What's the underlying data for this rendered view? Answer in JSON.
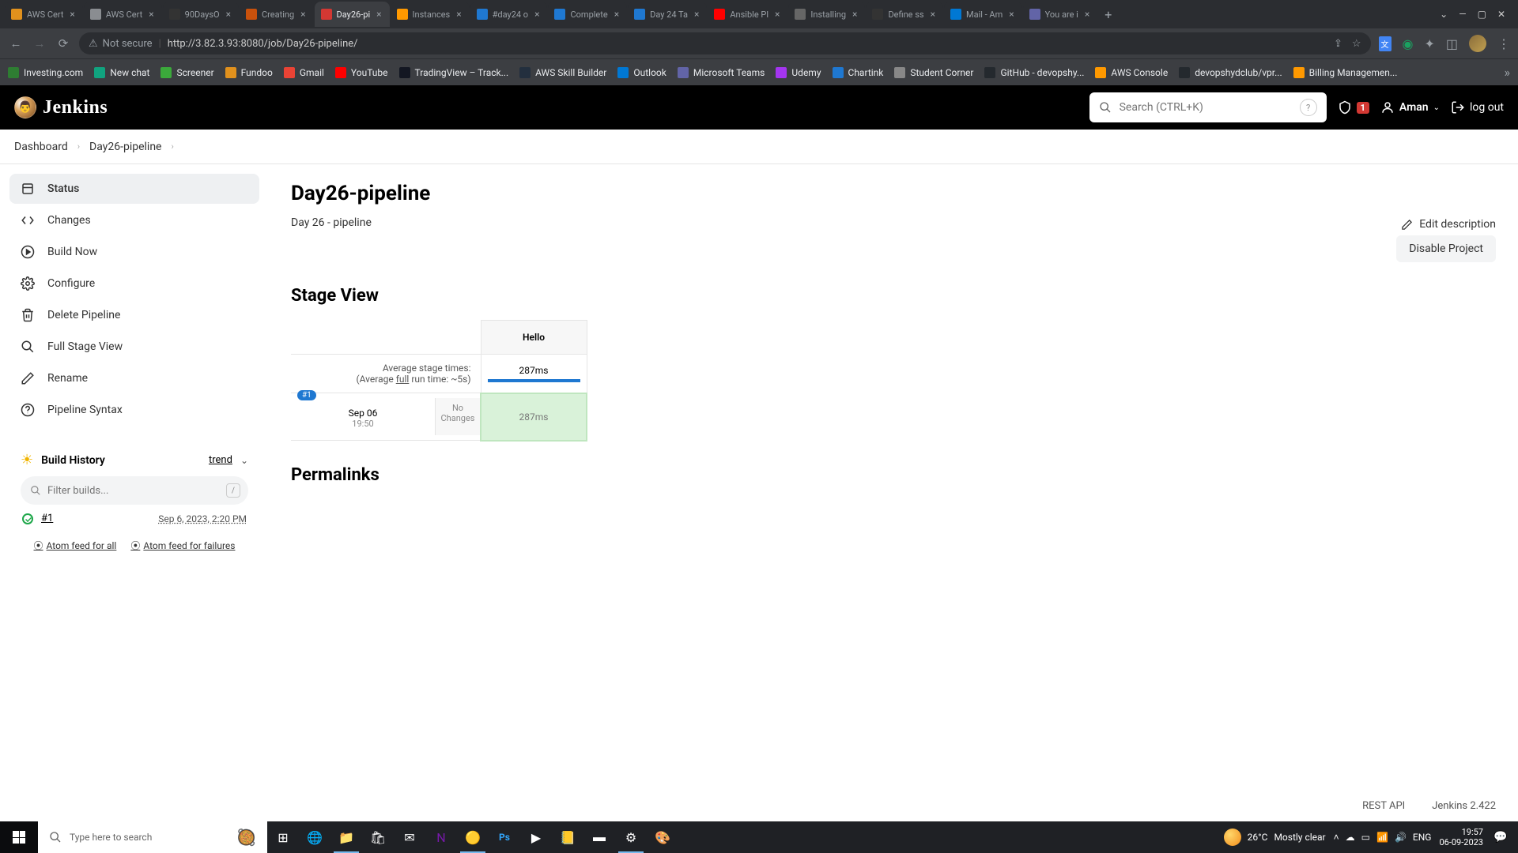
{
  "browser": {
    "tabs": [
      {
        "title": "AWS Cert",
        "favColor": "#e1911d"
      },
      {
        "title": "AWS Cert",
        "favColor": "#8a8d91"
      },
      {
        "title": "90DaysO",
        "favColor": "#333"
      },
      {
        "title": "Creating",
        "favColor": "#c9510c"
      },
      {
        "title": "Day26-pi",
        "favColor": "#d33833",
        "active": true
      },
      {
        "title": "Instances",
        "favColor": "#ff9900"
      },
      {
        "title": "#day24 o",
        "favColor": "#1f78d1"
      },
      {
        "title": "Complete",
        "favColor": "#1f78d1"
      },
      {
        "title": "Day 24 Ta",
        "favColor": "#1f78d1"
      },
      {
        "title": "Ansible Pl",
        "favColor": "#ff0000"
      },
      {
        "title": "Installing",
        "favColor": "#666"
      },
      {
        "title": "Define ss",
        "favColor": "#333"
      },
      {
        "title": "Mail - Am",
        "favColor": "#0078d4"
      },
      {
        "title": "You are i",
        "favColor": "#6264a7"
      }
    ],
    "not_secure": "Not secure",
    "url": "http://3.82.3.93:8080/job/Day26-pipeline/",
    "bookmarks": [
      {
        "label": "Investing.com",
        "color": "#2e7d32"
      },
      {
        "label": "New chat",
        "color": "#10a37f"
      },
      {
        "label": "Screener",
        "color": "#3ba93b"
      },
      {
        "label": "Fundoo",
        "color": "#e1911d"
      },
      {
        "label": "Gmail",
        "color": "#ea4335"
      },
      {
        "label": "YouTube",
        "color": "#ff0000"
      },
      {
        "label": "TradingView – Track...",
        "color": "#131722"
      },
      {
        "label": "AWS Skill Builder",
        "color": "#232f3e"
      },
      {
        "label": "Outlook",
        "color": "#0078d4"
      },
      {
        "label": "Microsoft Teams",
        "color": "#6264a7"
      },
      {
        "label": "Udemy",
        "color": "#a435f0"
      },
      {
        "label": "Chartink",
        "color": "#1f78d1"
      },
      {
        "label": "Student Corner",
        "color": "#888"
      },
      {
        "label": "GitHub - devopshy...",
        "color": "#24292e"
      },
      {
        "label": "AWS Console",
        "color": "#ff9900"
      },
      {
        "label": "devopshydclub/vpr...",
        "color": "#24292e"
      },
      {
        "label": "Billing Managemen...",
        "color": "#ff9900"
      }
    ]
  },
  "header": {
    "logo": "Jenkins",
    "search_placeholder": "Search (CTRL+K)",
    "alerts": "1",
    "user": "Aman",
    "logout": "log out"
  },
  "breadcrumbs": [
    "Dashboard",
    "Day26-pipeline"
  ],
  "sidebar": {
    "items": [
      {
        "label": "Status",
        "icon": "status"
      },
      {
        "label": "Changes",
        "icon": "changes"
      },
      {
        "label": "Build Now",
        "icon": "play"
      },
      {
        "label": "Configure",
        "icon": "gear"
      },
      {
        "label": "Delete Pipeline",
        "icon": "trash"
      },
      {
        "label": "Full Stage View",
        "icon": "search"
      },
      {
        "label": "Rename",
        "icon": "pencil"
      },
      {
        "label": "Pipeline Syntax",
        "icon": "help"
      }
    ],
    "build_history": {
      "title": "Build History",
      "trend": "trend",
      "filter_placeholder": "Filter builds...",
      "builds": [
        {
          "num": "#1",
          "date": "Sep 6, 2023, 2:20 PM"
        }
      ],
      "feed_all": "Atom feed for all",
      "feed_fail": "Atom feed for failures"
    }
  },
  "main": {
    "title": "Day26-pipeline",
    "description": "Day 26 - pipeline",
    "edit_desc": "Edit description",
    "disable": "Disable Project",
    "stage_view": {
      "title": "Stage View",
      "avg_label": "Average stage times:",
      "avg_sub_prefix": "(Average ",
      "avg_sub_full": "full",
      "avg_sub_suffix": " run time: ~5s)",
      "stages": [
        {
          "name": "Hello",
          "avg": "287ms"
        }
      ],
      "runs": [
        {
          "badge": "#1",
          "date": "Sep 06",
          "time": "19:50",
          "changes": "No Changes",
          "cells": [
            "287ms"
          ]
        }
      ]
    },
    "permalinks": "Permalinks",
    "footer": {
      "rest": "REST API",
      "version": "Jenkins 2.422"
    }
  },
  "taskbar": {
    "search_placeholder": "Type here to search",
    "weather_temp": "26°C",
    "weather_text": "Mostly clear",
    "lang": "ENG",
    "time": "19:57",
    "date": "06-09-2023"
  }
}
